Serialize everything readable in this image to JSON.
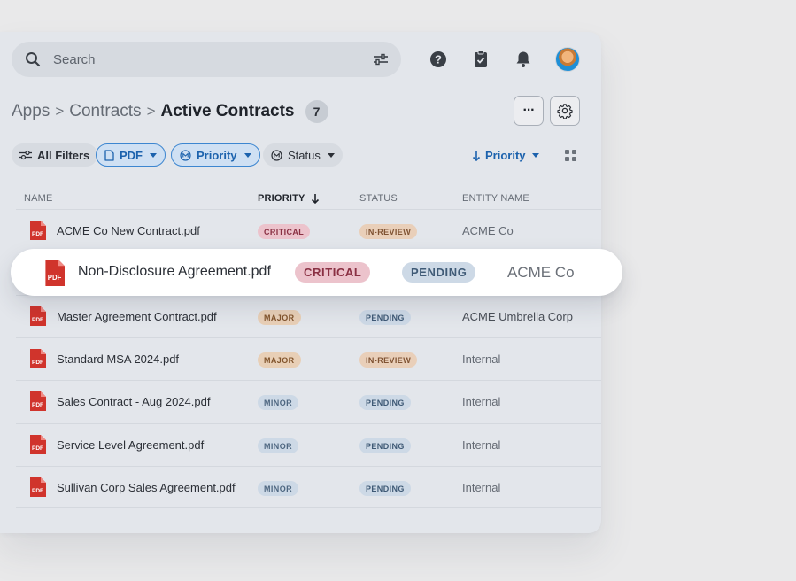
{
  "search": {
    "placeholder": "Search"
  },
  "breadcrumb": {
    "items": [
      "Apps",
      "Contracts"
    ],
    "current": "Active Contracts",
    "count": "7",
    "separator": ">"
  },
  "toolbar": {
    "more_label": "···"
  },
  "filters": {
    "all_filters": "All Filters",
    "pdf": "PDF",
    "priority": "Priority",
    "status": "Status",
    "sort_label": "Priority"
  },
  "columns": {
    "name": "NAME",
    "priority": "PRIORITY",
    "status": "STATUS",
    "entity": "ENTITY NAME"
  },
  "pdf_label": "PDF",
  "rows": [
    {
      "name": "ACME Co New Contract.pdf",
      "priority": "CRITICAL",
      "status": "IN-REVIEW",
      "entity": "ACME Co"
    },
    {
      "name": "Non-Disclosure Agreement.pdf",
      "priority": "CRITICAL",
      "status": "PENDING",
      "entity": "ACME Co"
    },
    {
      "name": "Master Agreement Contract.pdf",
      "priority": "MAJOR",
      "status": "PENDING",
      "entity": "ACME Umbrella Corp"
    },
    {
      "name": "Standard MSA 2024.pdf",
      "priority": "MAJOR",
      "status": "IN-REVIEW",
      "entity": "Internal"
    },
    {
      "name": "Sales Contract - Aug 2024.pdf",
      "priority": "MINOR",
      "status": "PENDING",
      "entity": "Internal"
    },
    {
      "name": "Service Level Agreement.pdf",
      "priority": "MINOR",
      "status": "PENDING",
      "entity": "Internal"
    },
    {
      "name": "Sullivan Corp Sales Agreement.pdf",
      "priority": "MINOR",
      "status": "PENDING",
      "entity": "Internal"
    }
  ],
  "icons": {
    "search": "search-icon",
    "filter": "sliders-icon",
    "help": "help-circle-icon",
    "clipboard": "clipboard-check-icon",
    "bell": "bell-icon",
    "settings": "gear-icon",
    "grid": "grid-view-icon",
    "file": "pdf-file-icon"
  },
  "colors": {
    "accent": "#1c62ad",
    "pdf_red": "#d0342c",
    "panel": "#e3e6eb"
  }
}
